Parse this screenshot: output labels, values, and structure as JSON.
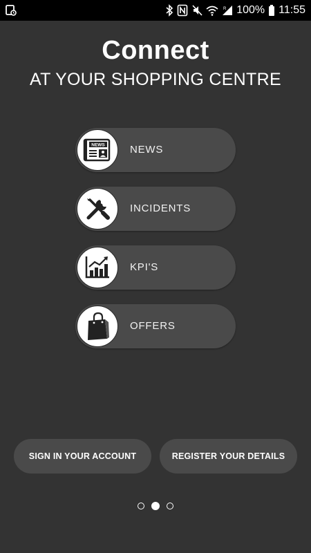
{
  "status_bar": {
    "battery": "100%",
    "time": "11:55",
    "icons": [
      "notification-icon",
      "bluetooth-icon",
      "nfc-icon",
      "mute-icon",
      "wifi-icon",
      "signal-icon",
      "battery-icon"
    ]
  },
  "header": {
    "title": "Connect",
    "subtitle": "AT YOUR SHOPPING CENTRE"
  },
  "menu": {
    "items": [
      {
        "label": "NEWS",
        "icon": "newspaper-icon"
      },
      {
        "label": "INCIDENTS",
        "icon": "tools-icon"
      },
      {
        "label": "KPI'S",
        "icon": "chart-icon"
      },
      {
        "label": "OFFERS",
        "icon": "shopping-bag-icon"
      }
    ]
  },
  "actions": {
    "sign_in": "SIGN IN YOUR ACCOUNT",
    "register": "REGISTER YOUR DETAILS"
  },
  "pager": {
    "pages": 3,
    "active_index": 2
  },
  "colors": {
    "background": "#333333",
    "pill": "#4a4a4a",
    "status_bar": "#000000",
    "text": "#ffffff"
  }
}
